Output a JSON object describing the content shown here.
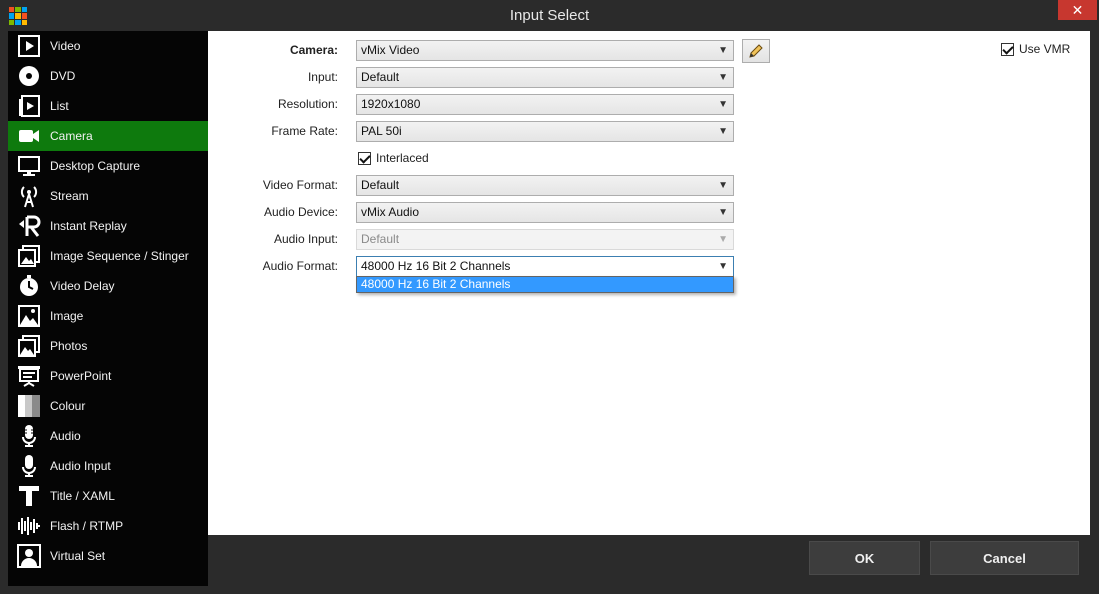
{
  "window": {
    "title": "Input Select",
    "close_glyph": "✕"
  },
  "sidebar": {
    "items": [
      {
        "label": "Video",
        "icon": "video-file-icon",
        "active": false
      },
      {
        "label": "DVD",
        "icon": "disc-icon",
        "active": false
      },
      {
        "label": "List",
        "icon": "list-icon",
        "active": false
      },
      {
        "label": "Camera",
        "icon": "camera-icon",
        "active": true
      },
      {
        "label": "Desktop Capture",
        "icon": "monitor-icon",
        "active": false
      },
      {
        "label": "Stream",
        "icon": "antenna-icon",
        "active": false
      },
      {
        "label": "Instant Replay",
        "icon": "replay-icon",
        "active": false
      },
      {
        "label": "Image Sequence / Stinger",
        "icon": "image-sequence-icon",
        "active": false
      },
      {
        "label": "Video Delay",
        "icon": "clock-icon",
        "active": false
      },
      {
        "label": "Image",
        "icon": "image-icon",
        "active": false
      },
      {
        "label": "Photos",
        "icon": "photos-icon",
        "active": false
      },
      {
        "label": "PowerPoint",
        "icon": "presentation-icon",
        "active": false
      },
      {
        "label": "Colour",
        "icon": "colour-icon",
        "active": false
      },
      {
        "label": "Audio",
        "icon": "microphone-icon",
        "active": false
      },
      {
        "label": "Audio Input",
        "icon": "microphone-input-icon",
        "active": false
      },
      {
        "label": "Title / XAML",
        "icon": "title-icon",
        "active": false
      },
      {
        "label": "Flash / RTMP",
        "icon": "waveform-icon",
        "active": false
      },
      {
        "label": "Virtual Set",
        "icon": "virtual-set-icon",
        "active": false
      }
    ]
  },
  "form": {
    "camera": {
      "label": "Camera:",
      "value": "vMix Video"
    },
    "input": {
      "label": "Input:",
      "value": "Default"
    },
    "resolution": {
      "label": "Resolution:",
      "value": "1920x1080"
    },
    "frame_rate": {
      "label": "Frame Rate:",
      "value": "PAL 50i"
    },
    "interlaced": {
      "label": "Interlaced",
      "checked": true
    },
    "video_format": {
      "label": "Video Format:",
      "value": "Default"
    },
    "audio_device": {
      "label": "Audio Device:",
      "value": "vMix Audio"
    },
    "audio_input": {
      "label": "Audio Input:",
      "value": "Default",
      "disabled": true
    },
    "audio_format": {
      "label": "Audio Format:",
      "value": "48000 Hz 16 Bit 2 Channels",
      "open": true,
      "options": [
        "48000 Hz 16 Bit 2 Channels"
      ]
    },
    "use_vmr": {
      "label": "Use VMR",
      "checked": true
    }
  },
  "footer": {
    "ok_label": "OK",
    "cancel_label": "Cancel"
  },
  "colors": {
    "accent_green": "#0e7a0d",
    "highlight_blue": "#3399ff",
    "close_red": "#c7372f"
  }
}
